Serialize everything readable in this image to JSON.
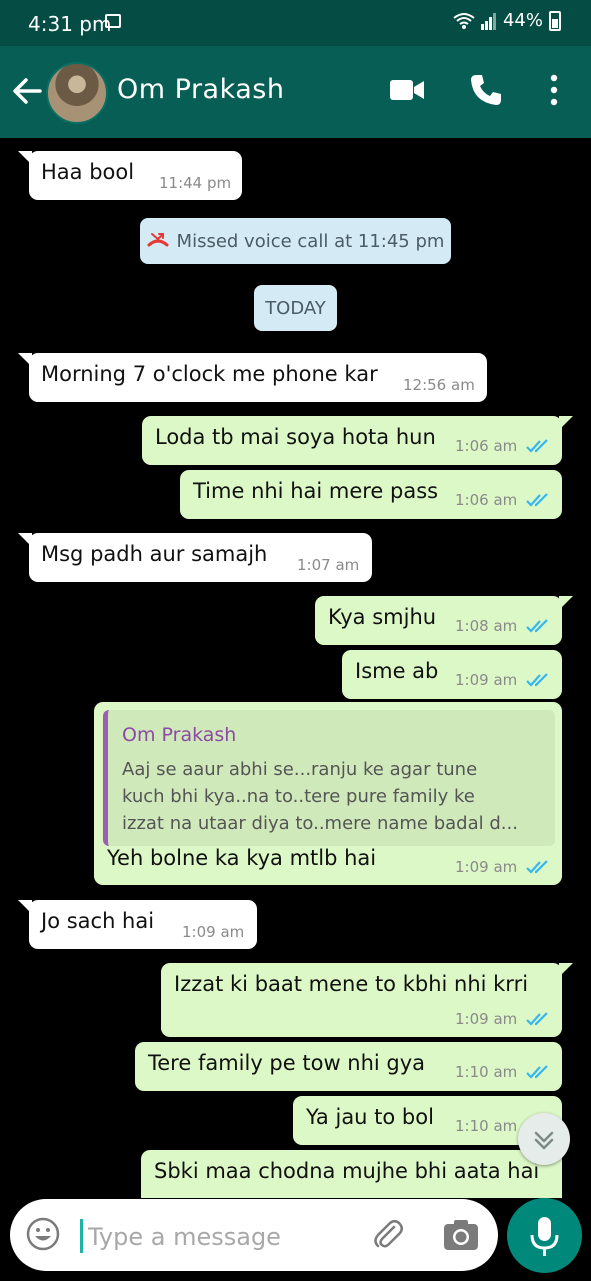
{
  "status_bar": {
    "time": "4:31 pm",
    "battery": "44%"
  },
  "header": {
    "contact_name": "Om Prakash"
  },
  "messages": [
    {
      "text": "Haa bool",
      "time": "11:44 pm"
    },
    {
      "text": "Morning 7 o'clock me phone kar",
      "time": "12:56 am"
    },
    {
      "text": "Loda tb mai soya hota hun",
      "time": "1:06 am"
    },
    {
      "text": "Time nhi hai mere pass",
      "time": "1:06 am"
    },
    {
      "text": "Msg padh aur samajh",
      "time": "1:07 am"
    },
    {
      "text": "Kya smjhu",
      "time": "1:08 am"
    },
    {
      "text": "Isme ab",
      "time": "1:09 am"
    },
    {
      "text": "Yeh bolne ka kya mtlb hai",
      "time": "1:09 am"
    },
    {
      "text": "Jo sach hai",
      "time": "1:09 am"
    },
    {
      "text": "Izzat ki baat mene to kbhi nhi krri",
      "time": "1:09 am"
    },
    {
      "text": "Tere family pe tow nhi gya",
      "time": "1:10 am"
    },
    {
      "text": "Ya jau to bol",
      "time": "1:10 am"
    },
    {
      "text": "Sbki maa chodna mujhe bhi aata hai",
      "time": ""
    }
  ],
  "system": {
    "missed_call": "Missed voice call at 11:45 pm",
    "date_chip": "TODAY"
  },
  "quoted": {
    "name": "Om Prakash",
    "lines": [
      "Aaj se aaur abhi se...ranju ke agar tune",
      "kuch bhi kya..na to..tere pure family ke",
      "izzat na utaar diya to..mere name badal d..."
    ]
  },
  "composer": {
    "placeholder": "Type a message"
  },
  "colors": {
    "header": "#075e54",
    "status_bar": "#054d44",
    "outgoing_bubble": "#dcf8c6",
    "incoming_bubble": "#ffffff",
    "read_ticks": "#34b7f1",
    "missed_call_red": "#e53935",
    "mic_button": "#00897b"
  },
  "icons": [
    "back-arrow-icon",
    "video-call-icon",
    "phone-icon",
    "more-options-icon",
    "missed-call-icon",
    "double-tick-icon",
    "scroll-down-icon",
    "emoji-icon",
    "attach-icon",
    "camera-icon",
    "mic-icon"
  ]
}
